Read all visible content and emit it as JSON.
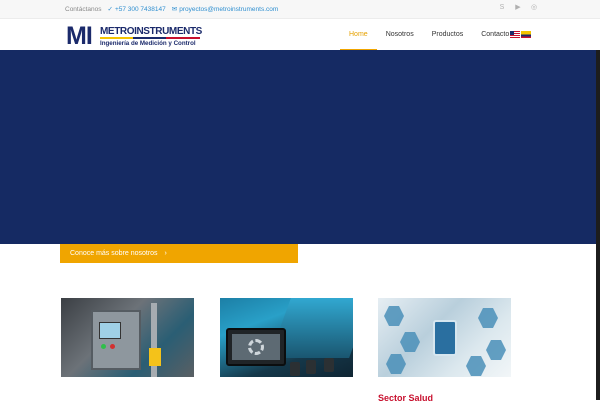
{
  "topbar": {
    "contact_label": "Contáctanos",
    "phone": "+57 300 7438147",
    "email": "proyectos@metroinstruments.com",
    "social_icons": [
      "skype-icon",
      "youtube-icon",
      "instagram-icon"
    ]
  },
  "header": {
    "logo": {
      "mark": "MI",
      "name": "METROINSTRUMENTS",
      "tagline": "Ingeniería de Medición y Control"
    },
    "nav": [
      {
        "label": "Home",
        "active": true
      },
      {
        "label": "Nosotros",
        "active": false
      },
      {
        "label": "Productos",
        "active": false
      },
      {
        "label": "Contacto",
        "active": false
      }
    ],
    "flags": [
      "us-flag-icon",
      "colombia-flag-icon"
    ]
  },
  "hero": {
    "background": "#152a63",
    "cta_label": "Conoce más sobre nosotros",
    "cta_arrow": "›",
    "cta_color": "#f0a500"
  },
  "cards": [
    {
      "image": "industrial control panel"
    },
    {
      "image": "automated measurement line"
    },
    {
      "image": "health technology icons"
    }
  ],
  "partial_label": "Sector Salud",
  "colors": {
    "brand_navy": "#1b2a6b",
    "accent_orange": "#f0a500",
    "brand_red": "#c8102e",
    "link_blue": "#2f8fd0"
  }
}
